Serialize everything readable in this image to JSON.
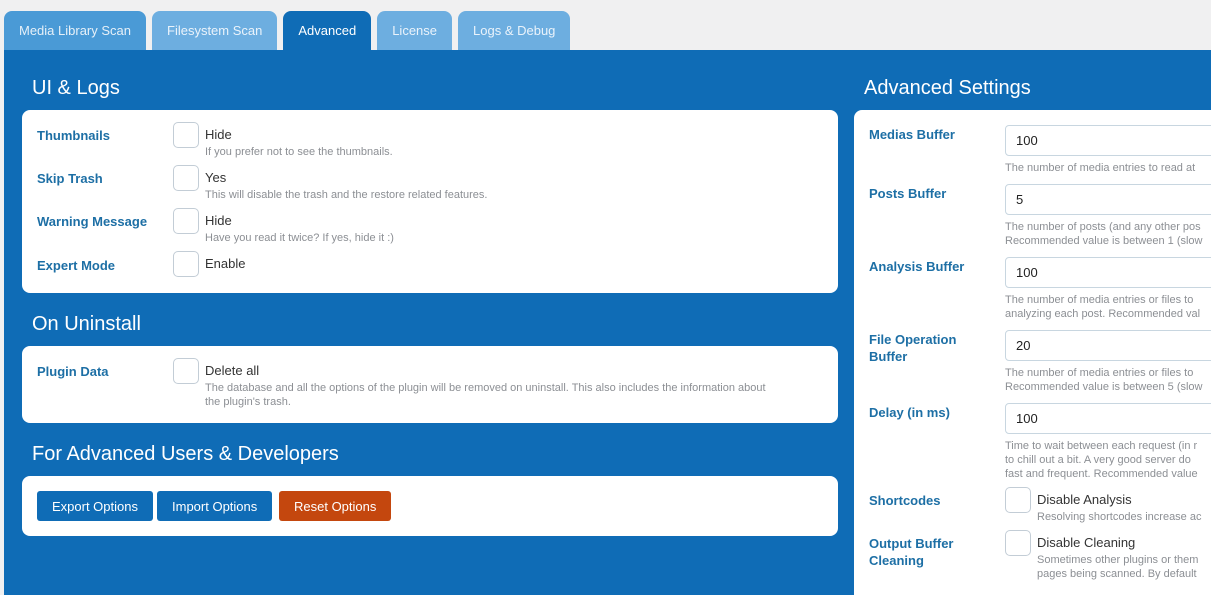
{
  "tabs": [
    {
      "label": "Media Library Scan",
      "state": "normal"
    },
    {
      "label": "Filesystem Scan",
      "state": "dim"
    },
    {
      "label": "Advanced",
      "state": "active"
    },
    {
      "label": "License",
      "state": "dim"
    },
    {
      "label": "Logs & Debug",
      "state": "dim"
    }
  ],
  "ui_logs": {
    "title": "UI & Logs",
    "rows": [
      {
        "label": "Thumbnails",
        "option": "Hide",
        "desc": "If you prefer not to see the thumbnails."
      },
      {
        "label": "Skip Trash",
        "option": "Yes",
        "desc": "This will disable the trash and the restore related features."
      },
      {
        "label": "Warning Message",
        "option": "Hide",
        "desc": "Have you read it twice? If yes, hide it :)"
      },
      {
        "label": "Expert Mode",
        "option": "Enable",
        "desc": ""
      }
    ]
  },
  "uninstall": {
    "title": "On Uninstall",
    "row": {
      "label": "Plugin Data",
      "option": "Delete all",
      "desc_line1": "The database and all the options of the plugin will be removed on uninstall. This also includes the information about",
      "desc_line2": "the plugin's trash."
    }
  },
  "developers": {
    "title": "For Advanced Users & Developers",
    "export_label": "Export Options",
    "import_label": "Import Options",
    "reset_label": "Reset Options"
  },
  "advanced": {
    "title": "Advanced Settings",
    "medias": {
      "label": "Medias Buffer",
      "value": "100",
      "desc1": "The number of media entries to read at"
    },
    "posts": {
      "label": "Posts Buffer",
      "value": "5",
      "desc1": "The number of posts (and any other pos",
      "desc2": "Recommended value is between 1 (slow"
    },
    "analysis": {
      "label": "Analysis Buffer",
      "value": "100",
      "desc1": "The number of media entries or files to",
      "desc2": "analyzing each post. Recommended val"
    },
    "fileop": {
      "label1": "File Operation",
      "label2": "Buffer",
      "value": "20",
      "desc1": "The number of media entries or files to",
      "desc2": "Recommended value is between 5 (slow"
    },
    "delay": {
      "label": "Delay (in ms)",
      "value": "100",
      "desc1": "Time to wait between each request (in r",
      "desc2": "to chill out a bit. A very good server do",
      "desc3": "fast and frequent. Recommended value"
    },
    "shortcodes": {
      "label": "Shortcodes",
      "option": "Disable Analysis",
      "desc1": "Resolving shortcodes increase ac"
    },
    "outbuf": {
      "label1": "Output Buffer",
      "label2": "Cleaning",
      "option": "Disable Cleaning",
      "desc1": "Sometimes other plugins or them",
      "desc2": "pages being scanned. By default"
    }
  },
  "colors": {
    "panel": "#0f6cb6",
    "label": "#1d6fa5",
    "reset": "#c4470e"
  }
}
